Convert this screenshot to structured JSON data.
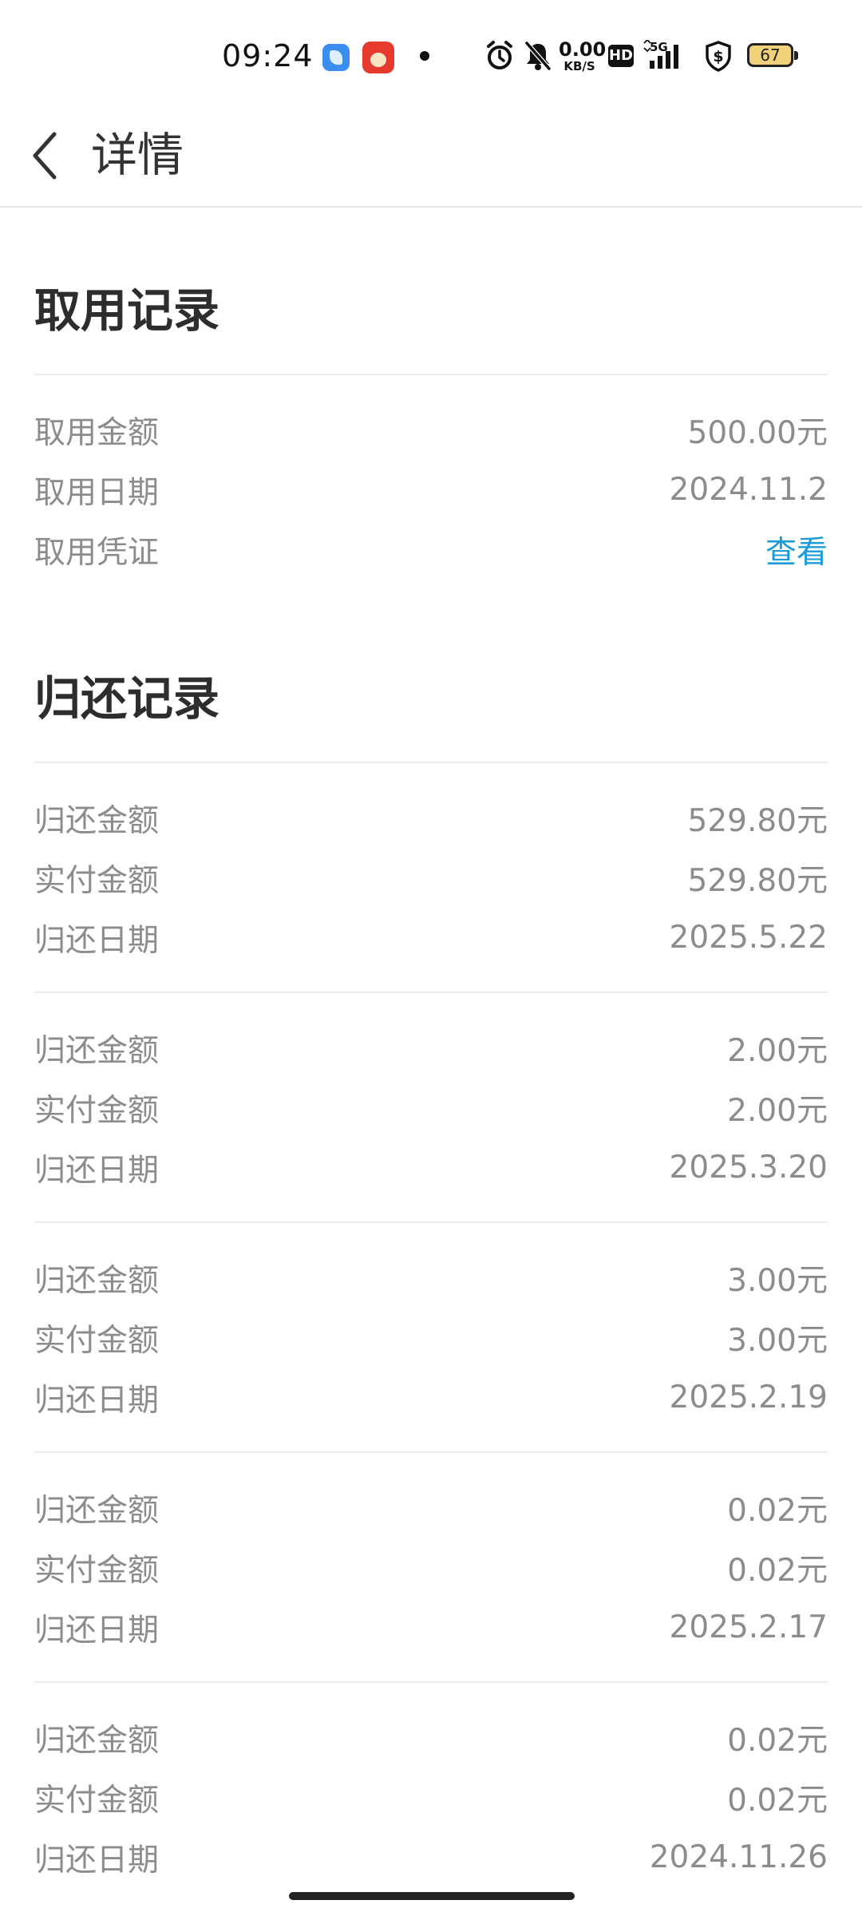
{
  "status_bar": {
    "time": "09:24",
    "net_speed_value": "0.00",
    "net_speed_unit": "KB/S",
    "hd": "HD",
    "signal": "5G",
    "battery": "67",
    "icons": [
      "app-icon-blue",
      "app-icon-food",
      "notification-dot",
      "alarm-icon",
      "mute-icon",
      "hd-icon",
      "signal-5g-icon",
      "shield-dollar-icon",
      "battery-icon"
    ]
  },
  "header": {
    "title": "详情"
  },
  "withdraw": {
    "title": "取用记录",
    "rows": [
      {
        "label": "取用金额",
        "value": "500.00元"
      },
      {
        "label": "取用日期",
        "value": "2024.11.2"
      }
    ],
    "voucher_label": "取用凭证",
    "voucher_link": "查看"
  },
  "repay": {
    "title": "归还记录",
    "records": [
      {
        "amount_label": "归还金额",
        "amount": "529.80元",
        "paid_label": "实付金额",
        "paid": "529.80元",
        "date_label": "归还日期",
        "date": "2025.5.22"
      },
      {
        "amount_label": "归还金额",
        "amount": "2.00元",
        "paid_label": "实付金额",
        "paid": "2.00元",
        "date_label": "归还日期",
        "date": "2025.3.20"
      },
      {
        "amount_label": "归还金额",
        "amount": "3.00元",
        "paid_label": "实付金额",
        "paid": "3.00元",
        "date_label": "归还日期",
        "date": "2025.2.19"
      },
      {
        "amount_label": "归还金额",
        "amount": "0.02元",
        "paid_label": "实付金额",
        "paid": "0.02元",
        "date_label": "归还日期",
        "date": "2025.2.17"
      },
      {
        "amount_label": "归还金额",
        "amount": "0.02元",
        "paid_label": "实付金额",
        "paid": "0.02元",
        "date_label": "归还日期",
        "date": "2024.11.26"
      }
    ]
  },
  "colors": {
    "link": "#1b9bd8",
    "text_muted": "#8c8c8c",
    "title": "#2d2d2d"
  }
}
